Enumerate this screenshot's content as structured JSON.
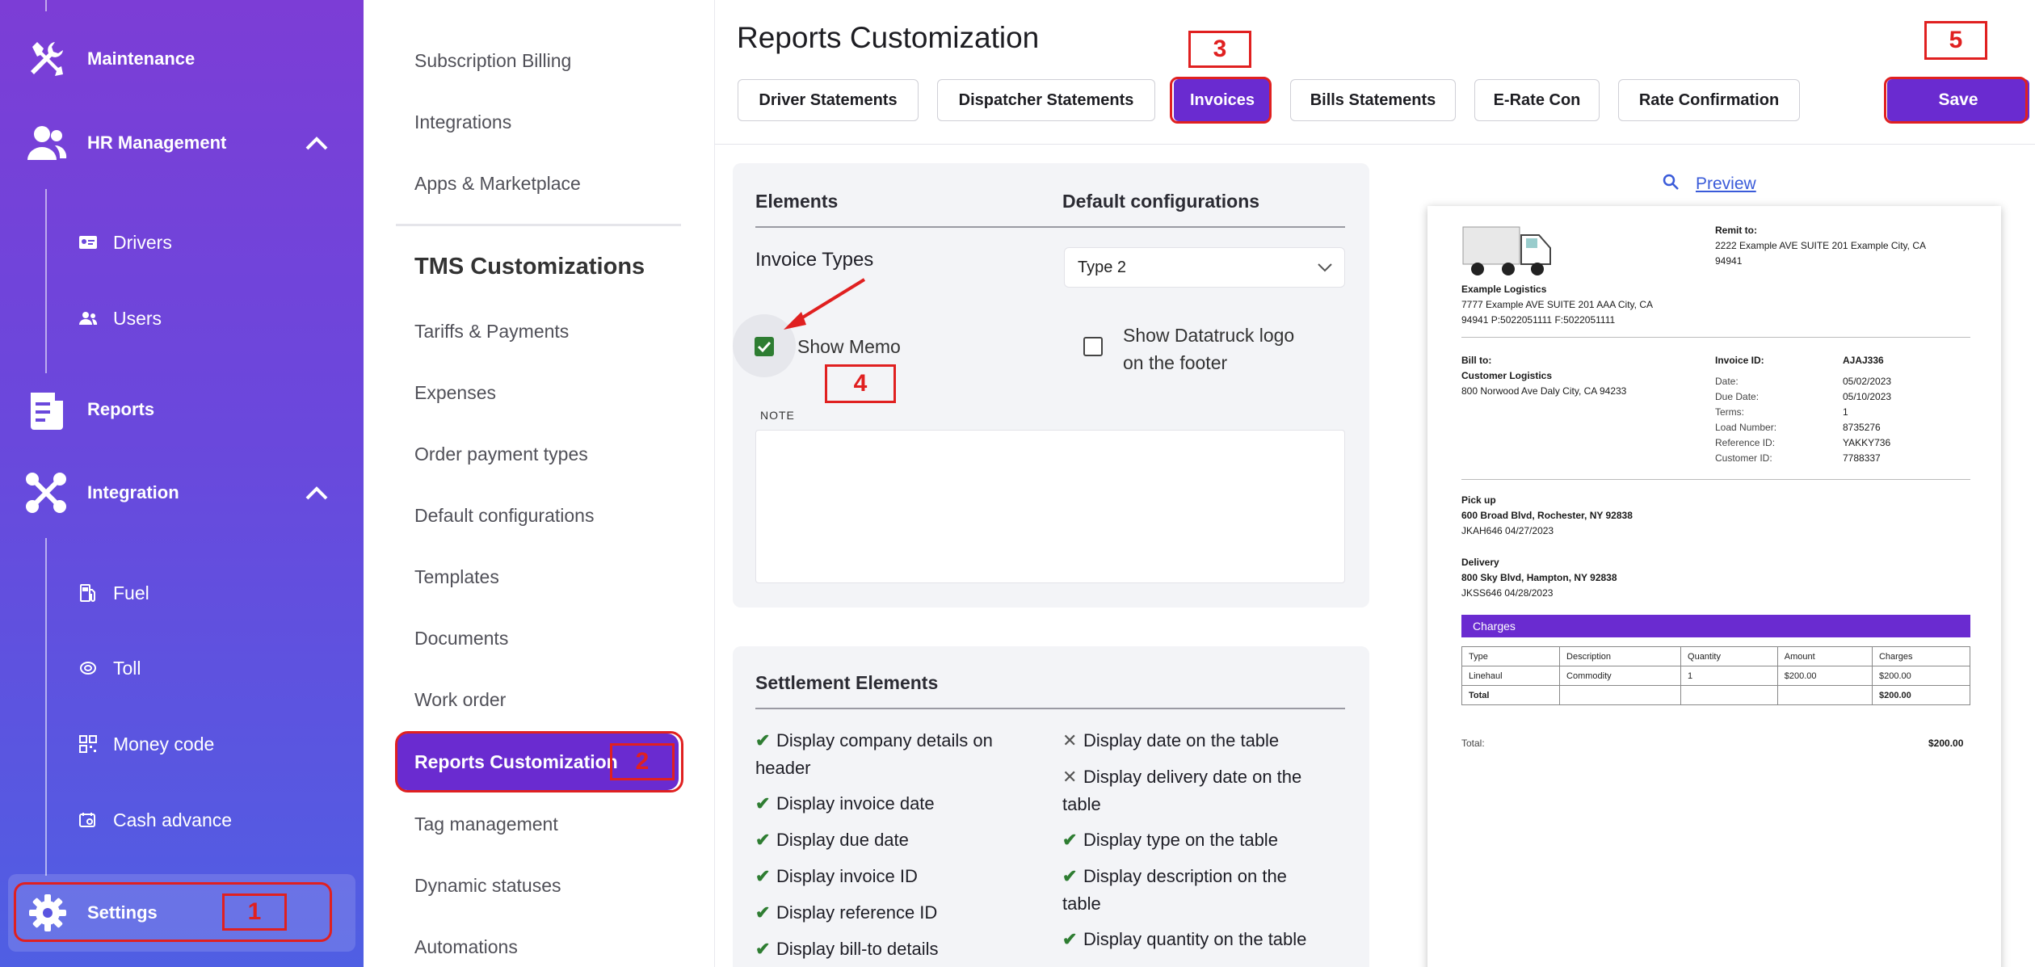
{
  "sidebar": {
    "items": [
      {
        "label": "Maintenance"
      },
      {
        "label": "HR Management"
      },
      {
        "label": "Reports"
      },
      {
        "label": "Integration"
      },
      {
        "label": "Settings"
      }
    ],
    "hr_sub": [
      {
        "label": "Drivers"
      },
      {
        "label": "Users"
      }
    ],
    "integration_sub": [
      {
        "label": "Fuel"
      },
      {
        "label": "Toll"
      },
      {
        "label": "Money code"
      },
      {
        "label": "Cash advance"
      }
    ]
  },
  "submenu": {
    "top_items": [
      "Subscription Billing",
      "Integrations",
      "Apps & Marketplace"
    ],
    "heading": "TMS Customizations",
    "items": [
      "Tariffs & Payments",
      "Expenses",
      "Order payment types",
      "Default configurations",
      "Templates",
      "Documents",
      "Work order",
      "Reports Customization",
      "Tag management",
      "Dynamic statuses",
      "Automations"
    ]
  },
  "header": {
    "title": "Reports Customization",
    "tabs": [
      "Driver Statements",
      "Dispatcher Statements",
      "Invoices",
      "Bills Statements",
      "E-Rate Con",
      "Rate Confirmation"
    ],
    "active_tab": "Invoices",
    "save_label": "Save"
  },
  "config": {
    "col_elements": "Elements",
    "col_defaults": "Default configurations",
    "invoice_types_label": "Invoice Types",
    "invoice_type_value": "Type 2",
    "show_memo_label": "Show Memo",
    "show_memo_checked": true,
    "show_logo_label_1": "Show Datatruck logo",
    "show_logo_label_2": "on the footer",
    "show_logo_checked": false,
    "note_label": "NOTE",
    "note_value": ""
  },
  "settlement": {
    "title": "Settlement Elements",
    "left": [
      {
        "mark": "check",
        "l1": "Display company details on",
        "l2": "header"
      },
      {
        "mark": "check",
        "l1": "Display invoice date",
        "l2": ""
      },
      {
        "mark": "check",
        "l1": "Display due date",
        "l2": ""
      },
      {
        "mark": "check",
        "l1": "Display invoice ID",
        "l2": ""
      },
      {
        "mark": "check",
        "l1": "Display reference ID",
        "l2": ""
      },
      {
        "mark": "check",
        "l1": "Display bill-to details",
        "l2": ""
      }
    ],
    "right": [
      {
        "mark": "cross",
        "l1": "Display date on the table",
        "l2": ""
      },
      {
        "mark": "cross",
        "l1": "Display delivery date on the",
        "l2": "table"
      },
      {
        "mark": "check",
        "l1": "Display type on the table",
        "l2": ""
      },
      {
        "mark": "check",
        "l1": "Display description on the",
        "l2": "table"
      },
      {
        "mark": "check",
        "l1": "Display quantity on the table",
        "l2": ""
      }
    ]
  },
  "preview": {
    "link": "Preview",
    "company": "Example Logistics",
    "company_addr1": "7777 Example AVE SUITE 201 AAA City, CA",
    "company_addr2": "94941 P:5022051111 F:5022051111",
    "remit_label": "Remit to:",
    "remit_addr1": "2222 Example AVE SUITE 201 Example City, CA",
    "remit_addr2": "94941",
    "bill_to_label": "Bill to:",
    "bill_to_name": "Customer Logistics",
    "bill_to_addr": "800 Norwood Ave Daly City, CA 94233",
    "invoice_id_label": "Invoice ID:",
    "invoice_id": "AJAJ336",
    "details": [
      {
        "k": "Date:",
        "v": "05/02/2023"
      },
      {
        "k": "Due Date:",
        "v": "05/10/2023"
      },
      {
        "k": "Terms:",
        "v": "1"
      },
      {
        "k": "Load Number:",
        "v": "8735276"
      },
      {
        "k": "Reference ID:",
        "v": "YAKKY736"
      },
      {
        "k": "Customer ID:",
        "v": "7788337"
      }
    ],
    "pickup_label": "Pick up",
    "pickup_addr": "600 Broad Blvd, Rochester, NY 92838",
    "pickup_ref": "JKAH646   04/27/2023",
    "delivery_label": "Delivery",
    "delivery_addr": "800 Sky Blvd, Hampton, NY 92838",
    "delivery_ref": "JKSS646   04/28/2023",
    "charges_label": "Charges",
    "table_headers": [
      "Type",
      "Description",
      "Quantity",
      "Amount",
      "Charges"
    ],
    "table_row": [
      "Linehaul",
      "Commodity",
      "1",
      "$200.00",
      "$200.00"
    ],
    "table_total": [
      "Total",
      "",
      "",
      "",
      "$200.00"
    ],
    "total_label": "Total:",
    "total_value": "$200.00"
  },
  "annotations": [
    "1",
    "2",
    "3",
    "4",
    "5"
  ],
  "colors": {
    "accent": "#6a2bd0",
    "annotation": "#e02020",
    "check": "#2e7d32"
  }
}
